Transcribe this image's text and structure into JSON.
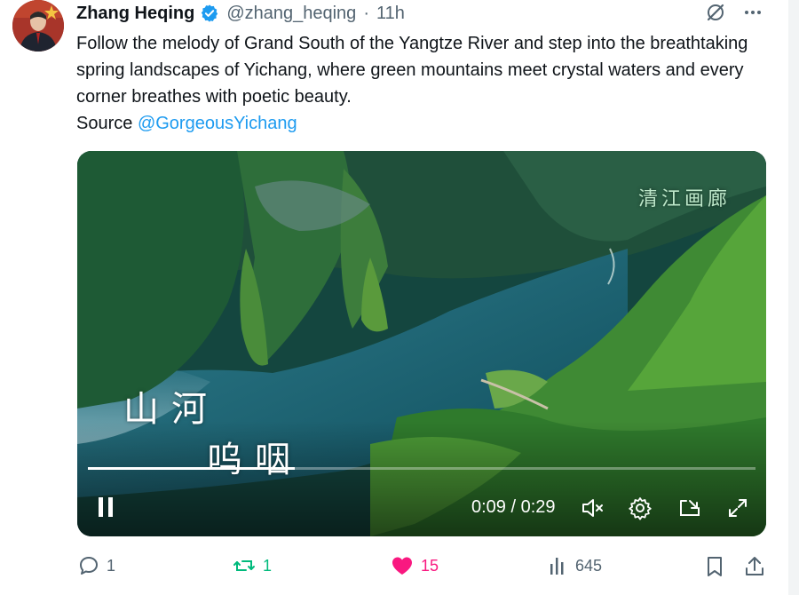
{
  "post": {
    "author_name": "Zhang Heqing",
    "author_handle": "@zhang_heqing",
    "separator": "·",
    "time_ago": "11h",
    "text": "Follow the melody of Grand South of the Yangtze River and step into the breathtaking spring landscapes of Yichang, where green mountains meet crystal waters and every corner breathes with poetic beauty.",
    "source_prefix": "Source",
    "source_mention": "@GorgeousYichang"
  },
  "video": {
    "overlay_text_line1": "山河",
    "overlay_text_line2": "呜咽",
    "overlay_text_corner": "清江画廊",
    "current_time": "0:09",
    "time_separator": "/",
    "duration": "0:29",
    "progress_fraction": 0.31
  },
  "actions": {
    "replies": "1",
    "reposts": "1",
    "likes": "15",
    "views": "645"
  },
  "colors": {
    "accent": "#1d9bf0",
    "repost": "#00ba7c",
    "like": "#f91880",
    "muted": "#536471"
  },
  "icons": {
    "verified": "verified-badge-icon",
    "grok": "grok-icon",
    "more": "more-icon",
    "pause": "pause-icon",
    "mute": "volume-muted-icon",
    "settings": "gear-icon",
    "pip": "pip-icon",
    "fullscreen": "fullscreen-icon",
    "reply": "reply-icon",
    "repost": "repost-icon",
    "like": "heart-icon",
    "views": "views-icon",
    "bookmark": "bookmark-icon",
    "share": "share-icon"
  }
}
